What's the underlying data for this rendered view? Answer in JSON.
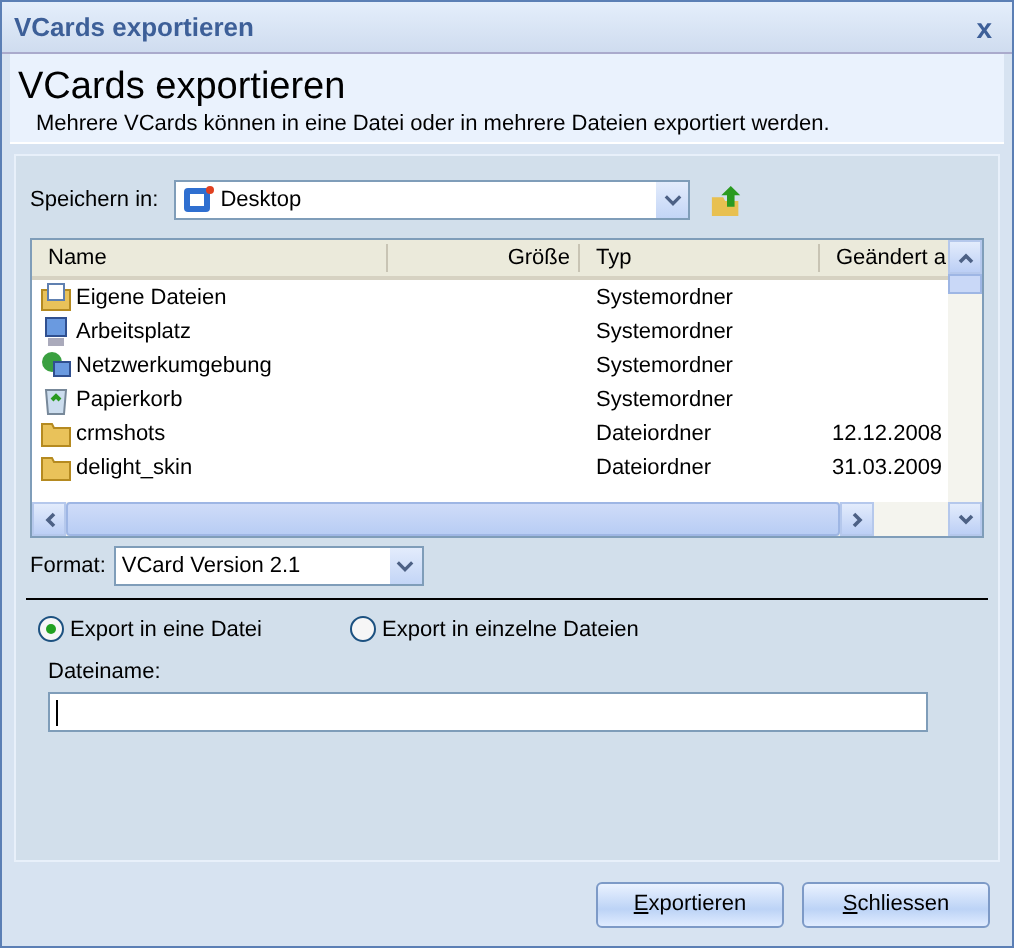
{
  "window": {
    "title": "VCards exportieren",
    "close": "x"
  },
  "header": {
    "title": "VCards exportieren",
    "description": "Mehrere VCards können in eine Datei oder in mehrere Dateien exportiert werden."
  },
  "save_in": {
    "label": "Speichern in:",
    "value": "Desktop"
  },
  "file_list": {
    "columns": [
      "Name",
      "Größe",
      "Typ",
      "Geändert a"
    ],
    "rows": [
      {
        "kind": "documents",
        "name": "Eigene Dateien",
        "type": "Systemordner"
      },
      {
        "kind": "computer",
        "name": "Arbeitsplatz",
        "type": "Systemordner"
      },
      {
        "kind": "network",
        "name": "Netzwerkumgebung",
        "type": "Systemordner"
      },
      {
        "kind": "recycle",
        "name": "Papierkorb",
        "type": "Systemordner"
      },
      {
        "kind": "folder",
        "name": "crmshots",
        "type": "Dateiordner",
        "modified": "12.12.2008"
      },
      {
        "kind": "folder",
        "name": "delight_skin",
        "type": "Dateiordner",
        "modified": "31.03.2009"
      }
    ]
  },
  "format": {
    "label": "Format:",
    "value": "VCard Version 2.1"
  },
  "export_mode": [
    {
      "label": "Export in eine Datei",
      "selected": true
    },
    {
      "label": "Export in einzelne Dateien",
      "selected": false
    }
  ],
  "filename": {
    "label": "Dateiname:"
  },
  "buttons": [
    "Exportieren",
    "Schliessen"
  ]
}
